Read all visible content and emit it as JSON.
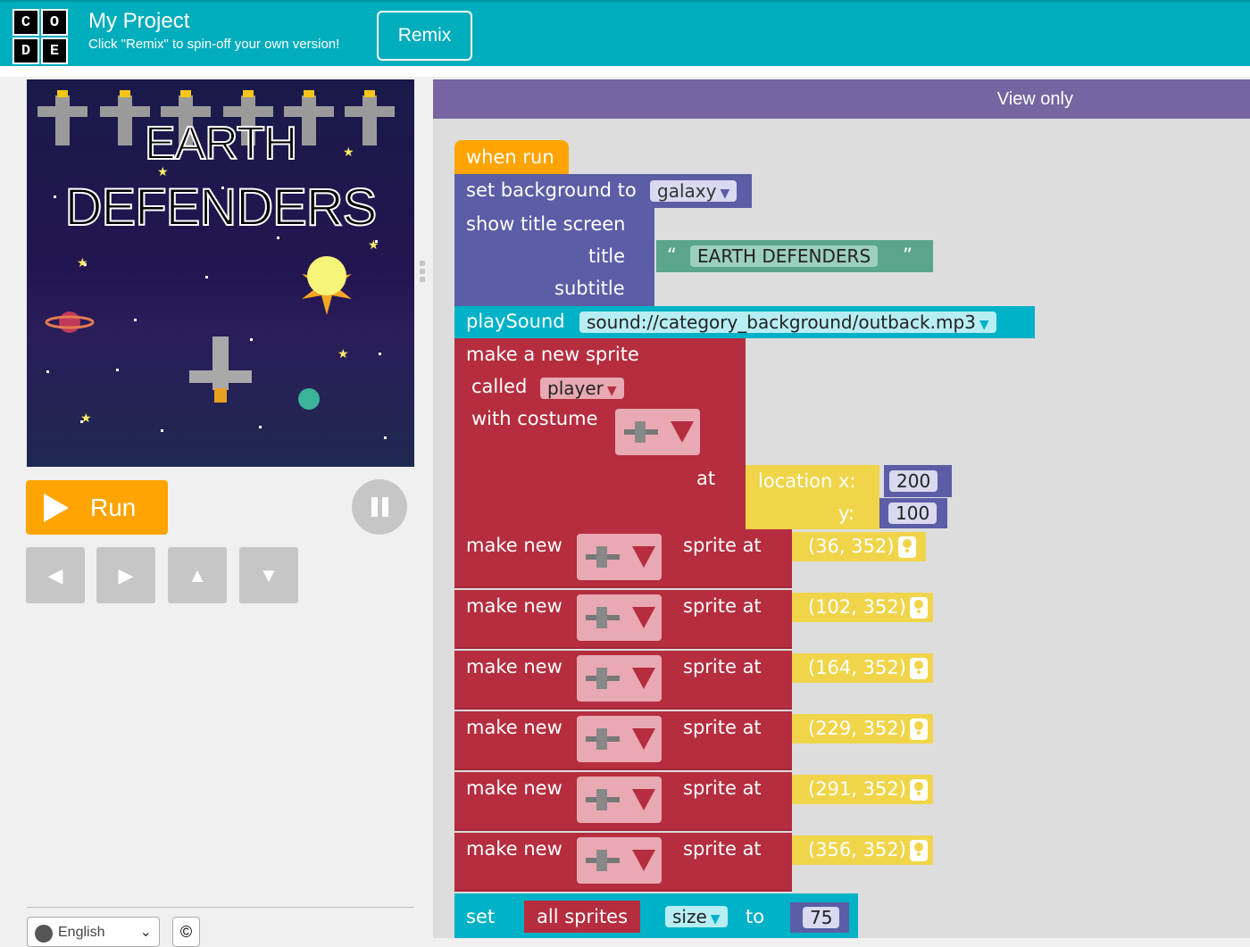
{
  "header": {
    "logo_letters": [
      "C",
      "O",
      "D",
      "E"
    ],
    "project_title": "My Project",
    "subtitle": "Click \"Remix\" to spin-off your own version!",
    "remix_label": "Remix"
  },
  "game": {
    "title_line1": "EARTH",
    "title_line2": "DEFENDERS"
  },
  "controls": {
    "run_label": "Run",
    "pause_icon": "pause-icon",
    "arrows": [
      "◀",
      "▶",
      "▲",
      "▼"
    ]
  },
  "footer": {
    "language": "English",
    "copyright_symbol": "©"
  },
  "workspace": {
    "view_mode": "View only",
    "blocks": {
      "when_run": "when run",
      "set_background": "set background to",
      "background_value": "galaxy",
      "show_title": "show title screen",
      "title_label": "title",
      "title_quote_open": "“",
      "title_value": "EARTH DEFENDERS",
      "title_quote_close": "”",
      "subtitle_label": "subtitle",
      "play_sound": "playSound",
      "sound_value": "sound://category_background/outback.mp3",
      "make_sprite": "make a new sprite",
      "called": "called",
      "sprite_name": "player",
      "with_costume": "with costume",
      "at": "at",
      "location_x": "location x:",
      "location_y": "y:",
      "x_value": "200",
      "y_value": "100",
      "make_new": "make new",
      "sprite_at": "sprite at",
      "positions": [
        "(36, 352)",
        "(102, 352)",
        "(164, 352)",
        "(229, 352)",
        "(291, 352)",
        "(356, 352)"
      ],
      "set": "set",
      "all_sprites": "all sprites",
      "property": "size",
      "to": "to",
      "size_value": "75"
    }
  },
  "colors": {
    "header": "#00adbc",
    "event_block": "#ffa400",
    "world_block": "#5b5ea6",
    "text_block": "#5ba58c",
    "sound_block": "#00b2c7",
    "sprite_block": "#b52d3f",
    "location_block": "#f0d54a",
    "math_block": "#5b5ea6",
    "view_bar": "#7665a0"
  }
}
